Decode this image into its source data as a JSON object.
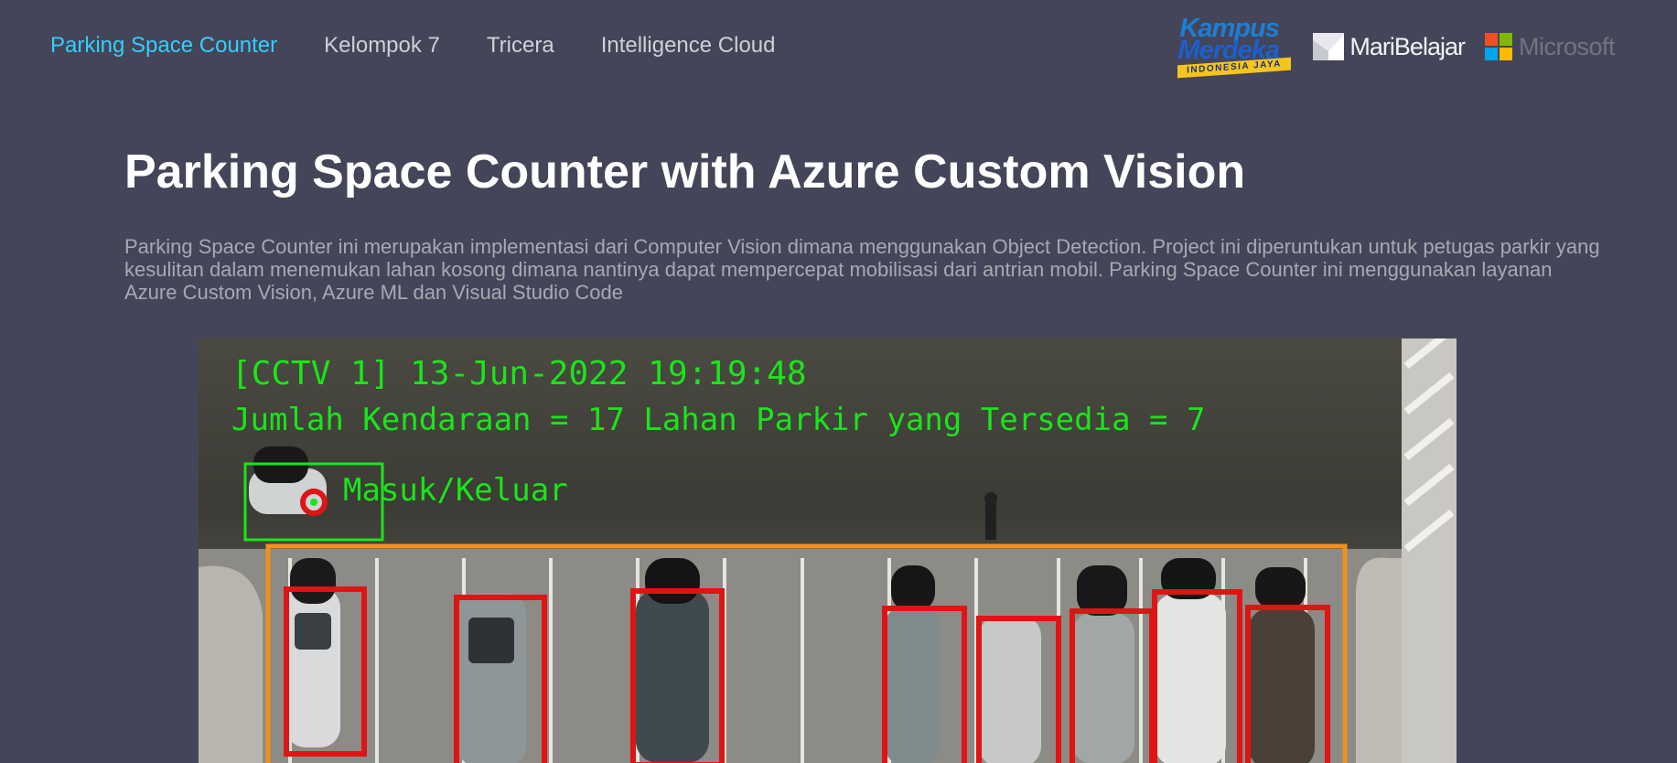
{
  "nav": {
    "links": [
      "Parking Space Counter",
      "Kelompok 7",
      "Tricera",
      "Intelligence Cloud"
    ],
    "active_index": 0
  },
  "logos": {
    "kampus_line1": "Kampus",
    "kampus_line2": "Merdeka",
    "kampus_ribbon": "INDONESIA JAYA",
    "maribelajar": "MariBelajar",
    "microsoft": "Microsoft"
  },
  "colors": {
    "background": "#444558",
    "active_link": "#33cfff",
    "detection_box": "#e01414",
    "parking_zone": "#f0901e",
    "overlay_text": "#19e619",
    "ms_red": "#f25022",
    "ms_green": "#7fba00",
    "ms_blue": "#00a4ef",
    "ms_yellow": "#ffb900"
  },
  "page": {
    "title": "Parking Space Counter with Azure Custom Vision",
    "description": "Parking Space Counter ini merupakan implementasi dari Computer Vision dimana menggunakan Object Detection. Project ini diperuntukan untuk petugas parkir yang kesulitan dalam menemukan lahan kosong dimana nantinya dapat mempercepat mobilisasi dari antrian mobil. Parking Space Counter ini menggunakan layanan Azure Custom Vision, Azure ML dan Visual Studio Code"
  },
  "video": {
    "cctv_label": "[CCTV 1] 13-Jun-2022 19:19:48",
    "counts_label": "Jumlah Kendaraan = 17  Lahan Parkir yang Tersedia = 7",
    "entry_label": "Masuk/Keluar",
    "vehicle_count": 17,
    "available_spaces": 7
  }
}
